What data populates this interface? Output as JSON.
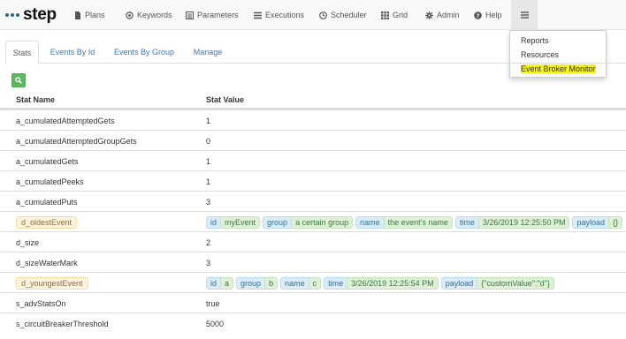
{
  "brand": {
    "name": "step"
  },
  "nav": {
    "items": [
      {
        "label": "Plans",
        "icon": "file-icon"
      },
      {
        "label": "Keywords",
        "icon": "target-icon"
      },
      {
        "label": "Parameters",
        "icon": "list-alt-icon"
      },
      {
        "label": "Executions",
        "icon": "tasks-icon"
      },
      {
        "label": "Scheduler",
        "icon": "clock-icon"
      },
      {
        "label": "Grid",
        "icon": "grid-icon"
      },
      {
        "label": "Admin",
        "icon": "gear-icon"
      },
      {
        "label": "Help",
        "icon": "question-icon"
      }
    ]
  },
  "menu": {
    "items": [
      {
        "label": "Reports"
      },
      {
        "label": "Resources"
      },
      {
        "label": "Event Broker Monitor"
      }
    ]
  },
  "tabs": [
    {
      "label": "Stats",
      "active": true
    },
    {
      "label": "Events By Id",
      "active": false
    },
    {
      "label": "Events By Group",
      "active": false
    },
    {
      "label": "Manage",
      "active": false
    }
  ],
  "table": {
    "headers": {
      "name": "Stat Name",
      "value": "Stat Value"
    },
    "rows": [
      {
        "name": "a_cumulatedAttemptedGets",
        "value": "1"
      },
      {
        "name": "a_cumulatedAttemptedGroupGets",
        "value": "0"
      },
      {
        "name": "a_cumulatedGets",
        "value": "1"
      },
      {
        "name": "a_cumulatedPeeks",
        "value": "1"
      },
      {
        "name": "a_cumulatedPuts",
        "value": "3"
      },
      {
        "name": "d_oldestEvent",
        "pairs": [
          {
            "k": "id",
            "v": "myEvent"
          },
          {
            "k": "group",
            "v": "a certain group"
          },
          {
            "k": "name",
            "v": "the event's name"
          },
          {
            "k": "time",
            "v": "3/26/2019 12:25:50 PM"
          },
          {
            "k": "payload",
            "v": "{}"
          }
        ]
      },
      {
        "name": "d_size",
        "value": "2"
      },
      {
        "name": "d_sizeWaterMark",
        "value": "3"
      },
      {
        "name": "d_youngestEvent",
        "pairs": [
          {
            "k": "id",
            "v": "a"
          },
          {
            "k": "group",
            "v": "b"
          },
          {
            "k": "name",
            "v": "c"
          },
          {
            "k": "time",
            "v": "3/26/2019 12:25:54 PM"
          },
          {
            "k": "payload",
            "v": "{\"customValue\":\"d\"}"
          }
        ]
      },
      {
        "name": "s_advStatsOn",
        "value": "true"
      },
      {
        "name": "s_circuitBreakerThreshold",
        "value": "5000"
      }
    ]
  },
  "colors": {
    "accent": "#337ab7",
    "success": "#5cb85c",
    "highlight": "#f6f40a"
  }
}
